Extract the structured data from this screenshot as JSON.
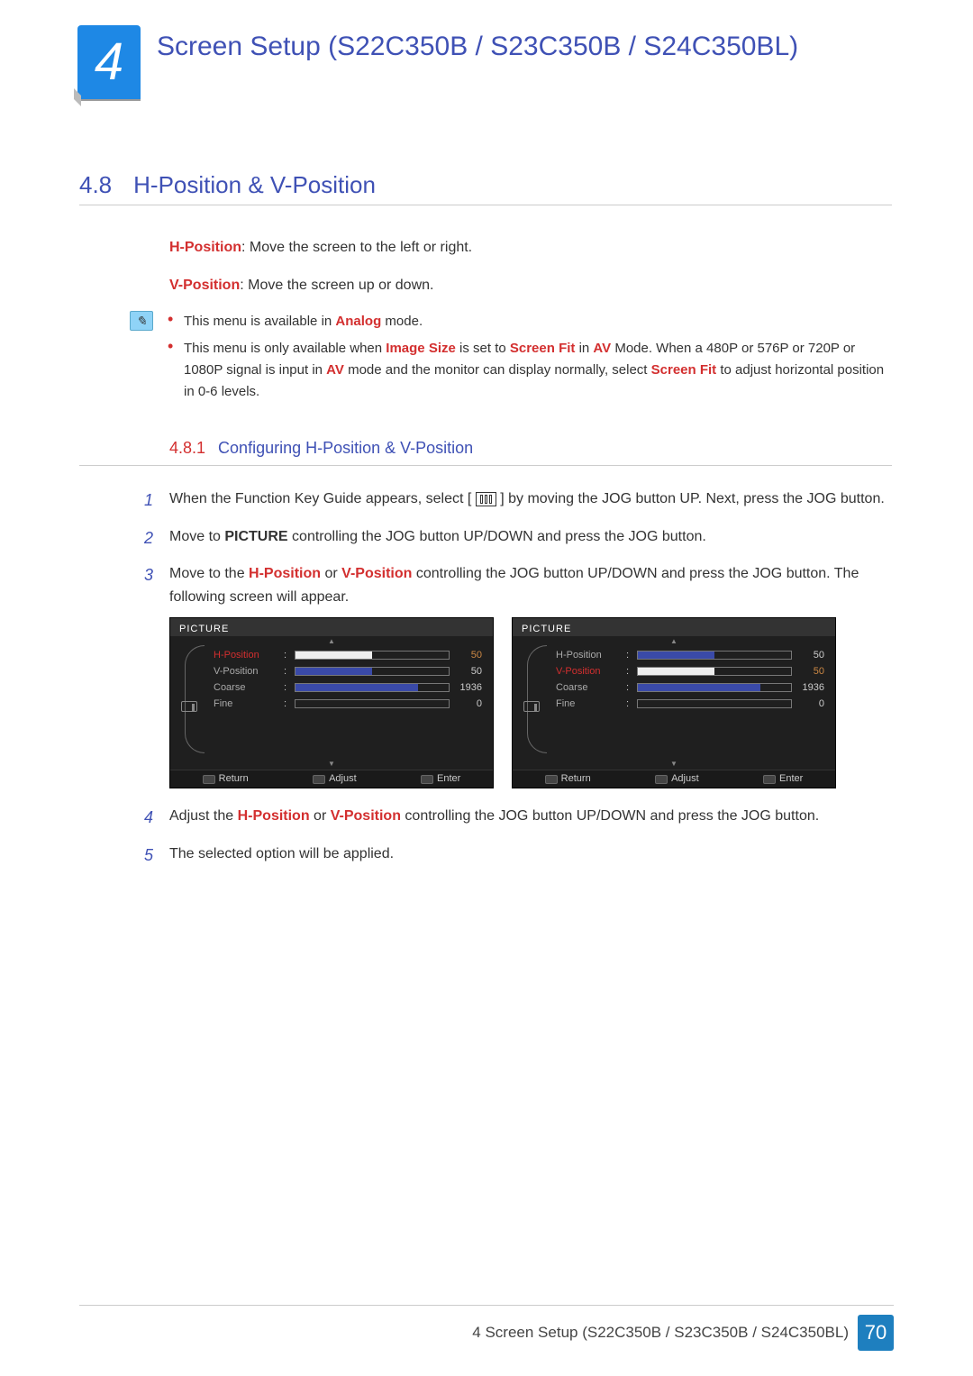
{
  "chapter": {
    "num": "4",
    "title": "Screen Setup (S22C350B / S23C350B / S24C350BL)"
  },
  "section": {
    "num": "4.8",
    "title": "H-Position & V-Position"
  },
  "definitions": {
    "hpos_term": "H-Position",
    "hpos_desc": ": Move the screen to the left or right.",
    "vpos_term": "V-Position",
    "vpos_desc": ": Move the screen up or down."
  },
  "notes": {
    "n1_a": "This menu is available in ",
    "n1_b": "Analog",
    "n1_c": " mode.",
    "n2_a": "This menu is only available when ",
    "n2_b": "Image Size",
    "n2_c": " is set to ",
    "n2_d": "Screen Fit",
    "n2_e": " in ",
    "n2_f": "AV",
    "n2_g": " Mode. When a 480P or 576P or 720P or 1080P signal is input in ",
    "n2_h": "AV",
    "n2_i": " mode and the monitor can display normally, select ",
    "n2_j": "Screen Fit",
    "n2_k": " to adjust horizontal position in 0-6 levels."
  },
  "subsection": {
    "num": "4.8.1",
    "title": "Configuring H-Position & V-Position"
  },
  "steps": {
    "s1a": "When the Function Key Guide appears, select [",
    "s1b": "] by moving the JOG button UP. Next, press the JOG button.",
    "s2a": "Move to ",
    "s2b": "PICTURE",
    "s2c": " controlling the JOG button UP/DOWN and press the JOG button.",
    "s3a": "Move to the ",
    "s3b": "H-Position",
    "s3c": " or  ",
    "s3d": "V-Position",
    "s3e": " controlling the JOG button UP/DOWN and press the JOG button. The following screen will appear.",
    "s4a": "Adjust the ",
    "s4b": "H-Position",
    "s4c": " or ",
    "s4d": "V-Position",
    "s4e": " controlling the JOG button UP/DOWN and press the JOG button.",
    "s5": "The selected option will be applied."
  },
  "step_nums": {
    "n1": "1",
    "n2": "2",
    "n3": "3",
    "n4": "4",
    "n5": "5"
  },
  "osd": {
    "title": "PICTURE",
    "rows": {
      "hpos": "H-Position",
      "vpos": "V-Position",
      "coarse": "Coarse",
      "fine": "Fine"
    },
    "vals": {
      "hpos": "50",
      "vpos": "50",
      "coarse": "1936",
      "fine": "0"
    },
    "footer": {
      "ret": "Return",
      "adj": "Adjust",
      "ent": "Enter"
    }
  },
  "footer": {
    "chap_ref": "4 Screen Setup (S22C350B / S23C350B / S24C350BL)",
    "page": "70"
  }
}
